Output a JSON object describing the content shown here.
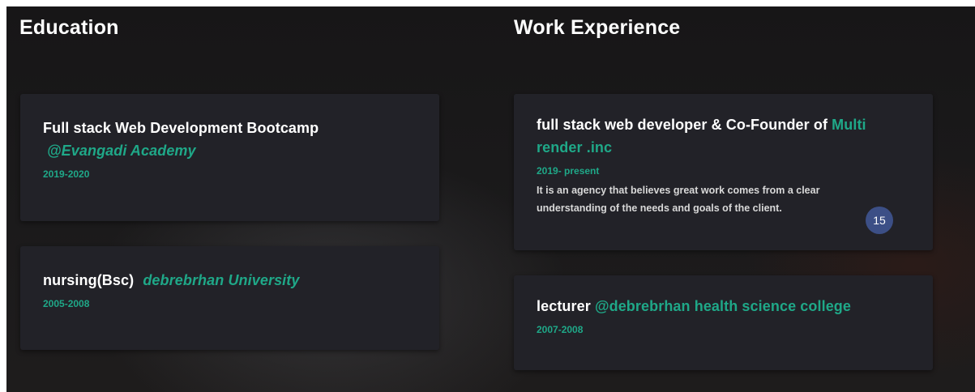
{
  "education": {
    "title": "Education",
    "items": [
      {
        "title": "Full stack Web Development Bootcamp",
        "institution": "@Evangadi Academy",
        "years": "2019-2020"
      },
      {
        "title": "nursing(Bsc)",
        "institution": "debrebrhan University",
        "years": "2005-2008"
      }
    ]
  },
  "work": {
    "title": "Work Experience",
    "items": [
      {
        "role": "full stack web developer & Co-Founder of",
        "company": "Multi render .inc",
        "years": "2019- present",
        "description": "It is an agency that believes great work comes from a clear understanding of the needs and goals of the client."
      },
      {
        "role": "lecturer",
        "company": "@debrebrhan health science college",
        "years": "2007-2008"
      }
    ]
  },
  "badge": {
    "number": "15"
  },
  "colors": {
    "accent": "#1fa888",
    "card": "#222228",
    "badge": "#3c4f86"
  }
}
